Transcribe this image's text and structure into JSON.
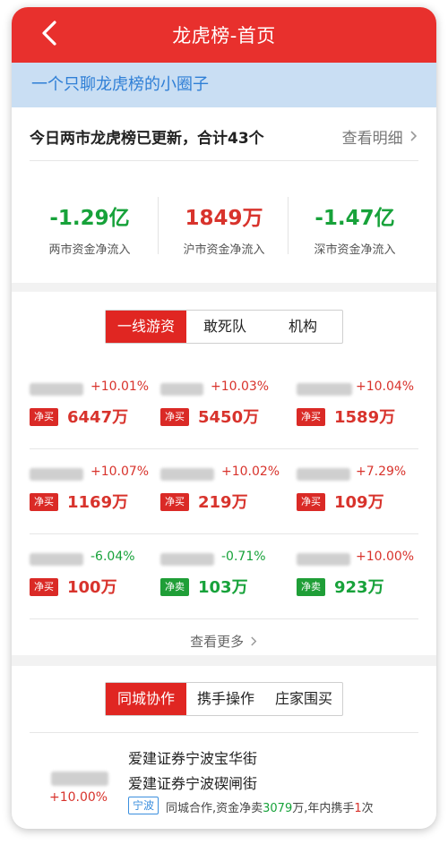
{
  "nav": {
    "title": "龙虎榜-首页"
  },
  "banner": {
    "text": "一个只聊龙虎榜的小圈子"
  },
  "summary": {
    "headline": "今日两市龙虎榜已更新，合计43个",
    "detail_link": "查看明细",
    "stats": [
      {
        "value": "-1.29亿",
        "label": "两市资金净流入"
      },
      {
        "value": "1849万",
        "label": "沪市资金净流入"
      },
      {
        "value": "-1.47亿",
        "label": "深市资金净流入"
      }
    ]
  },
  "investor_tabs": [
    "一线游资",
    "敢死队",
    "机构"
  ],
  "stocks": [
    {
      "pct": "+10.01%",
      "tag": "净买",
      "amount": "6447万"
    },
    {
      "pct": "+10.03%",
      "tag": "净买",
      "amount": "5450万"
    },
    {
      "pct": "+10.04%",
      "tag": "净买",
      "amount": "1589万"
    },
    {
      "pct": "+10.07%",
      "tag": "净买",
      "amount": "1169万"
    },
    {
      "pct": "+10.02%",
      "tag": "净买",
      "amount": "219万"
    },
    {
      "pct": "+7.29%",
      "tag": "净买",
      "amount": "109万"
    },
    {
      "pct": "-6.04%",
      "tag": "净买",
      "amount": "100万"
    },
    {
      "pct": "-0.71%",
      "tag": "净卖",
      "amount": "103万"
    },
    {
      "pct": "+10.00%",
      "tag": "净卖",
      "amount": "923万"
    }
  ],
  "see_more": "查看更多",
  "coop_tabs": [
    "同城协作",
    "携手操作",
    "庄家围买"
  ],
  "coop": {
    "pct": "+10.00%",
    "broker1": "爱建证券宁波宝华街",
    "broker2": "爱建证券宁波碶闸街",
    "city": "宁波",
    "desc_prefix": "同城合作,资金净卖",
    "desc_amount": "3079",
    "desc_mid": "万,年内携手",
    "desc_count": "1",
    "desc_suffix": "次"
  },
  "colors": {
    "accent_red": "#e8302d",
    "up_red": "#d8332c",
    "down_green": "#17a23a",
    "banner_blue": "#2f7fd6"
  }
}
